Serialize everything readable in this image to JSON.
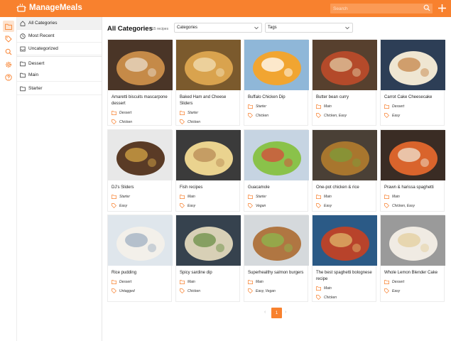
{
  "app": {
    "title": "ManageMeals"
  },
  "search": {
    "placeholder": "Search"
  },
  "sidebar": {
    "items": [
      {
        "label": "All Categories",
        "icon": "home-icon",
        "active": true
      },
      {
        "label": "Most Recent",
        "icon": "clock-icon",
        "active": false
      },
      {
        "label": "Uncategorized",
        "icon": "inbox-icon",
        "active": false
      },
      {
        "label": "Dessert",
        "icon": "folder-icon",
        "active": false
      },
      {
        "label": "Main",
        "icon": "folder-icon",
        "active": false
      },
      {
        "label": "Starter",
        "icon": "folder-icon",
        "active": false
      }
    ]
  },
  "rail": {
    "icons": [
      "folder-icon",
      "tag-icon",
      "search-icon",
      "gear-icon",
      "help-icon"
    ]
  },
  "main": {
    "title": "All Categories",
    "count": "15 recipes",
    "category_select": "Categories",
    "tags_select": "Tags"
  },
  "recipes": [
    {
      "title": "Amaretti biscuits mascarpone dessert",
      "category": "Dessert",
      "tags": "Chicken"
    },
    {
      "title": "Baked Ham and Cheese Sliders",
      "category": "Starter",
      "tags": "Chicken"
    },
    {
      "title": "Buffalo Chicken Dip",
      "category": "Starter",
      "tags": "Chicken"
    },
    {
      "title": "Butter bean curry",
      "category": "Main",
      "tags": "Chicken, Easy"
    },
    {
      "title": "Carrot Cake Cheesecake",
      "category": "Dessert",
      "tags": "Easy"
    },
    {
      "title": "DJ's Sliders",
      "category": "Starter",
      "tags": "Easy"
    },
    {
      "title": "Fish recipes",
      "category": "Main",
      "tags": "Easy"
    },
    {
      "title": "Guacamole",
      "category": "Starter",
      "tags": "Vegan"
    },
    {
      "title": "One-pot chicken & rice",
      "category": "Main",
      "tags": "Easy"
    },
    {
      "title": "Prawn & harissa spaghetti",
      "category": "Main",
      "tags": "Chicken, Easy"
    },
    {
      "title": "Rice pudding",
      "category": "Dessert",
      "tags": "Untagged"
    },
    {
      "title": "Spicy sardine dip",
      "category": "Main",
      "tags": "Chicken"
    },
    {
      "title": "Superhealthy salmon burgers",
      "category": "Main",
      "tags": "Easy, Vegan"
    },
    {
      "title": "The best spaghetti bolognese recipe",
      "category": "Main",
      "tags": "Chicken"
    },
    {
      "title": "Whole Lemon Blender Cake",
      "category": "Dessert",
      "tags": "Easy"
    }
  ],
  "pagination": {
    "current": "1"
  },
  "colors": {
    "accent": "#f8812e"
  }
}
